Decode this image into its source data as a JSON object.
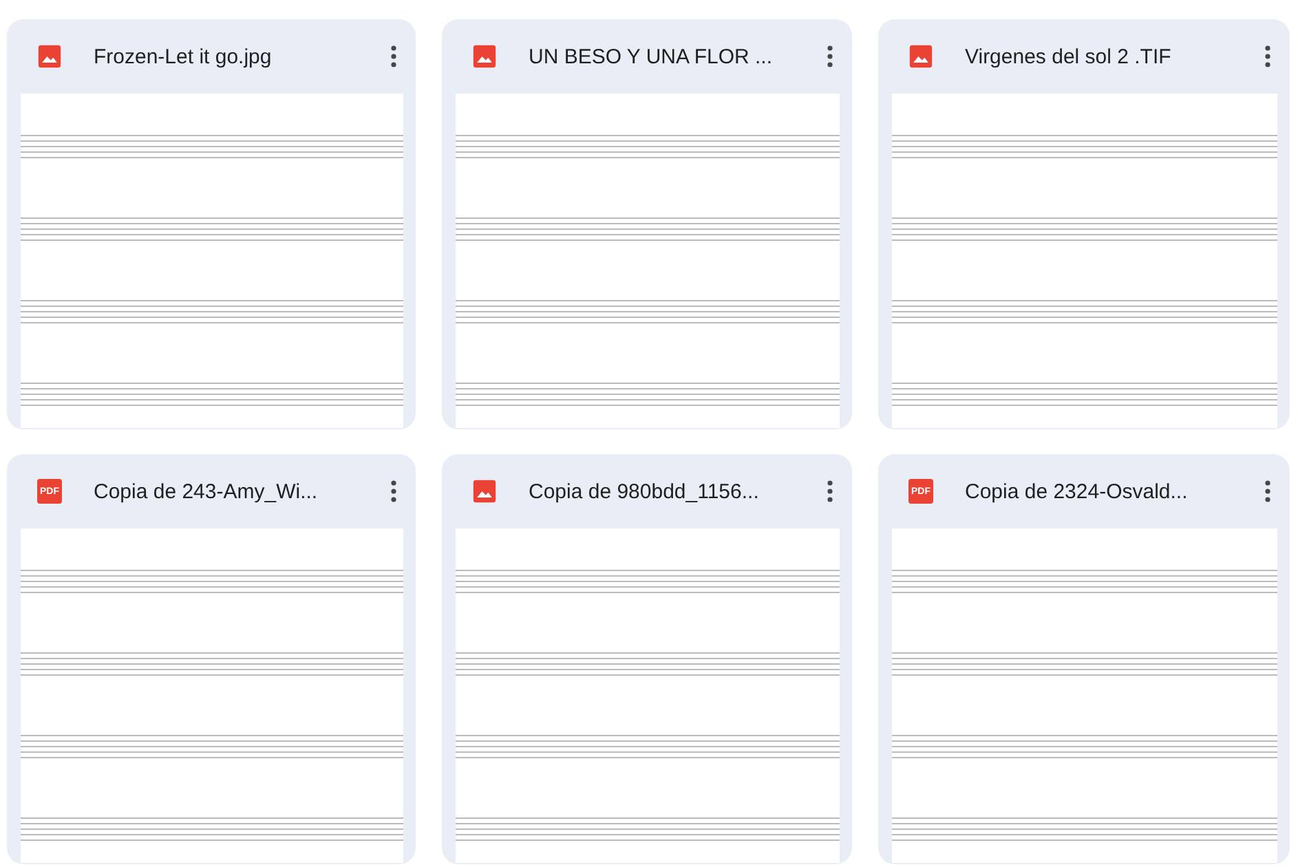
{
  "files": [
    {
      "kind": "image",
      "name": "Frozen-Let it go.jpg"
    },
    {
      "kind": "image",
      "name": "UN BESO Y UNA FLOR ..."
    },
    {
      "kind": "image",
      "name": "Virgenes del sol 2 .TIF"
    },
    {
      "kind": "pdf",
      "icon_label": "PDF",
      "name": "Copia de 243-Amy_Wi..."
    },
    {
      "kind": "image",
      "name": "Copia de 980bdd_1156..."
    },
    {
      "kind": "pdf",
      "icon_label": "PDF",
      "name": "Copia de 2324-Osvald..."
    }
  ]
}
